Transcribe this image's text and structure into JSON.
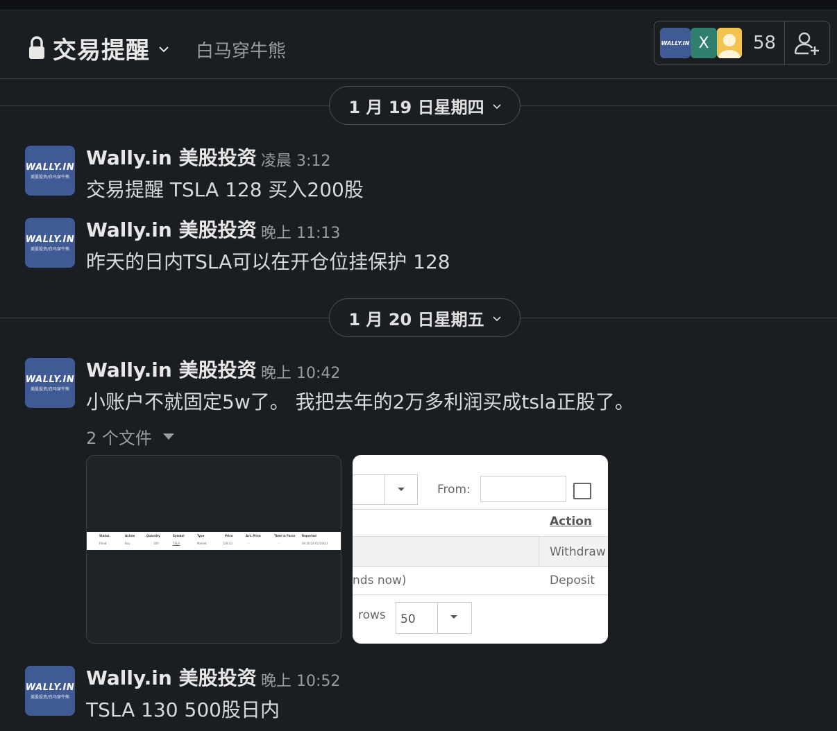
{
  "channel": {
    "name": "交易提醒",
    "topic": "白马穿牛熊",
    "member_count": "58",
    "member_avatar_x": "X"
  },
  "avatar": {
    "line1": "WALLY.IN",
    "line2": "美股投资/白马穿牛熊"
  },
  "days": [
    {
      "label": "1 月 19 日星期四"
    },
    {
      "label": "1 月 20 日星期五"
    }
  ],
  "messages": [
    {
      "author": "Wally.in 美股投资",
      "time": "凌晨 3:12",
      "text": "交易提醒 TSLA 128 买入200股"
    },
    {
      "author": "Wally.in 美股投资",
      "time": "晚上 11:13",
      "text": "昨天的日内TSLA可以在开仓位挂保护 128"
    },
    {
      "author": "Wally.in 美股投资",
      "time": "晚上 10:42",
      "text": "小账户不就固定5w了。 我把去年的2万多利润买成tsla正股了。"
    },
    {
      "author": "Wally.in 美股投资",
      "time": "晚上 10:52",
      "text": "TSLA 130 500股日内"
    }
  ],
  "files": {
    "label": "2 个文件",
    "file1": {
      "headers": [
        "Status",
        "Action",
        "Quantity",
        "Symbol",
        "Type",
        "Price",
        "Act. Price",
        "Time in Force",
        "Reported"
      ],
      "row": [
        "Filled",
        "Buy",
        "100",
        "TSLA",
        "Market",
        "128.33",
        "-",
        "-",
        "09:30:34 01/19/23"
      ]
    },
    "file2": {
      "from_label": "From:",
      "action_header": "Action",
      "cell_withdraw": "Withdraw",
      "cell_deposit": "Deposit",
      "cell_partial": "nds now)",
      "rows_label": "rows",
      "rows_value": "50"
    }
  },
  "colors": {
    "background": "#1a1d21",
    "avatar_blue": "#3f5a94"
  }
}
